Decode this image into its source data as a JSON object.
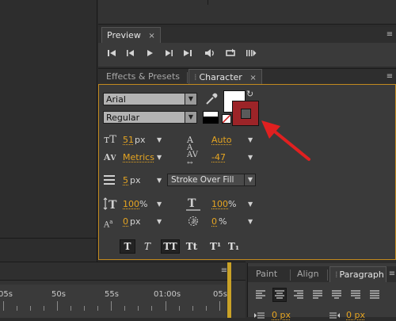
{
  "preview": {
    "tab_label": "Preview",
    "close": "×",
    "menu": "≡"
  },
  "character": {
    "tabs": [
      {
        "label": "Effects & Presets",
        "close": ""
      },
      {
        "label": "Character",
        "close": "×"
      }
    ],
    "menu": "≡",
    "font_family": "Arial",
    "font_style": "Regular",
    "font_size": {
      "value": "51",
      "unit": "px"
    },
    "leading": {
      "value": "Auto"
    },
    "kerning": {
      "value": "Metrics"
    },
    "tracking": {
      "value": "-47"
    },
    "stroke_width": {
      "value": "5",
      "unit": "px"
    },
    "stroke_mode": "Stroke Over Fill",
    "vertical_scale": {
      "value": "100",
      "unit": "%"
    },
    "horizontal_scale": {
      "value": "100",
      "unit": "%"
    },
    "baseline_shift": {
      "value": "0",
      "unit": "px"
    },
    "tsume": {
      "value": "0",
      "unit": "%"
    },
    "style_buttons": [
      "T",
      "T",
      "TT",
      "Tt",
      "T¹",
      "T₁"
    ],
    "fill_color": "#ffffff",
    "stroke_color": "#9c2428"
  },
  "bottom_panel": {
    "tabs": [
      {
        "label": "Paint"
      },
      {
        "label": "Align"
      },
      {
        "label": "Paragraph"
      }
    ],
    "menu": "≡",
    "row2_values": [
      "0 px",
      "0 px"
    ]
  },
  "timeline": {
    "menu": "≡",
    "ruler_labels": [
      "05s",
      "50s",
      "55s",
      "01:00s",
      "05s"
    ]
  },
  "annotation": {
    "arrow_color": "#e02020"
  }
}
